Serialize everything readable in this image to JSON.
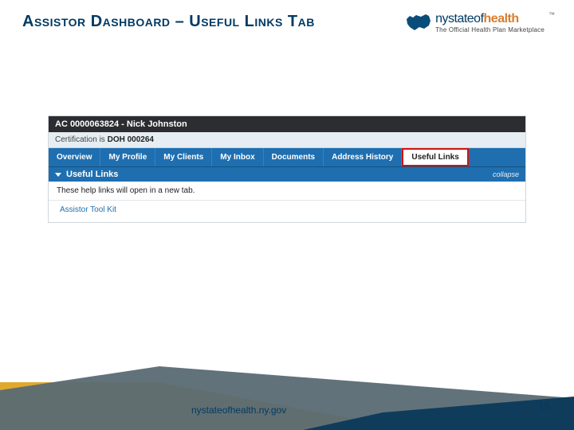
{
  "slide": {
    "title": "Assistor Dashboard – Useful Links Tab"
  },
  "logo": {
    "main_pre": "nystateof",
    "main_accent": "health",
    "tagline": "The Official Health Plan Marketplace",
    "tm": "™"
  },
  "dashboard": {
    "account_line": "AC 0000063824 - Nick  Johnston",
    "cert_label": "Certification is",
    "cert_value": "DOH 000264",
    "tabs": [
      "Overview",
      "My Profile",
      "My Clients",
      "My Inbox",
      "Documents",
      "Address History",
      "Useful Links"
    ],
    "active_tab_index": 6,
    "section_title": "Useful Links",
    "collapse_label": "collapse",
    "note": "These help links will open in a new tab.",
    "link": "Assistor Tool Kit"
  },
  "footer": {
    "url": "nystateofhealth.ny.gov",
    "page": "15"
  },
  "colors": {
    "brand_blue": "#003a63",
    "tab_blue": "#1f6fb0",
    "highlight_red": "#d11313",
    "accent_orange": "#d97d2e"
  }
}
